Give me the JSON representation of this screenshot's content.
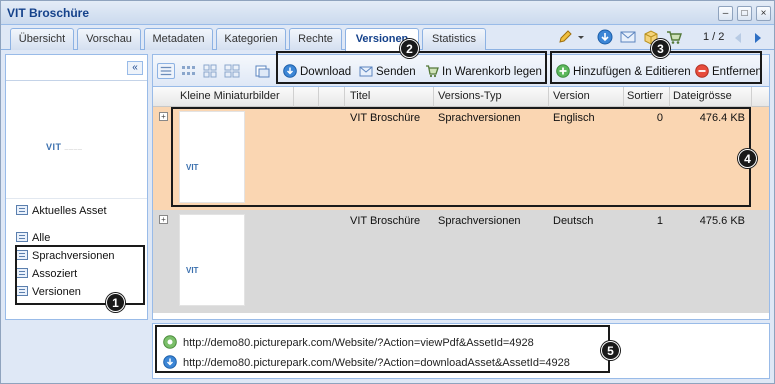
{
  "window": {
    "title": "VIT Broschüre",
    "controls": [
      "–",
      "□",
      "×"
    ]
  },
  "tabs": [
    {
      "label": "Übersicht",
      "active": false
    },
    {
      "label": "Vorschau",
      "active": false
    },
    {
      "label": "Metadaten",
      "active": false
    },
    {
      "label": "Kategorien",
      "active": false
    },
    {
      "label": "Rechte",
      "active": false
    },
    {
      "label": "Versionen",
      "active": true
    },
    {
      "label": "Statistics",
      "active": false
    }
  ],
  "header_tools": {
    "icons": [
      "pencil-icon",
      "dropdown-arrow-icon",
      "download-icon",
      "mail-icon",
      "package-icon",
      "cart-icon"
    ],
    "pager": "1 / 2",
    "prev_icon": "arrow-left-icon",
    "next_icon": "arrow-right-icon"
  },
  "left_panel": {
    "collapse_label": "«",
    "thumbnail_text": "VIT",
    "nav_items": [
      {
        "label": "Aktuelles Asset"
      },
      {
        "label": "Alle"
      },
      {
        "label": "Sprachversionen"
      },
      {
        "label": "Assoziert"
      },
      {
        "label": "Versionen"
      }
    ]
  },
  "toolbar": {
    "download_label": "Download",
    "send_label": "Senden",
    "cart_label": "In Warenkorb legen",
    "add_label": "Hinzufügen & Editieren",
    "remove_label": "Entfernen"
  },
  "grid": {
    "columns": [
      "Kleine Miniaturbilder",
      "Titel",
      "Versions-Typ",
      "Version",
      "Sortierr",
      "Dateigrösse"
    ],
    "rows": [
      {
        "thumb": "VIT",
        "title": "VIT Broschüre",
        "type": "Sprachversionen",
        "version": "Englisch",
        "sort": "0",
        "size": "476.4 KB",
        "selected": true
      },
      {
        "thumb": "VIT",
        "title": "VIT Broschüre",
        "type": "Sprachversionen",
        "version": "Deutsch",
        "sort": "1",
        "size": "475.6 KB",
        "selected": false
      }
    ]
  },
  "links": [
    {
      "url": "http://demo80.picturepark.com/Website/?Action=viewPdf&AssetId=4928",
      "icon": "view-pdf-icon"
    },
    {
      "url": "http://demo80.picturepark.com/Website/?Action=downloadAsset&AssetId=4928",
      "icon": "download-icon"
    }
  ],
  "callouts": [
    "1",
    "2",
    "3",
    "4",
    "5"
  ],
  "colors": {
    "selected_row": "#fad6b2",
    "unselected_row": "#d9d9d9",
    "accent": "#15428b"
  }
}
